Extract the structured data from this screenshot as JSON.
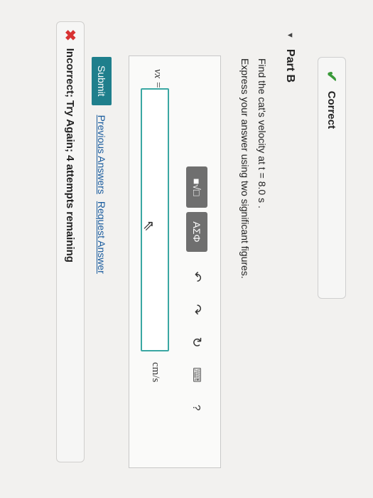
{
  "correct_panel": {
    "label": "Correct"
  },
  "part": {
    "title": "Part B"
  },
  "question": {
    "line1": "Find the cat's velocity at t = 8.0 s .",
    "line2": "Express your answer using two significant figures."
  },
  "answer": {
    "variable": "vx =",
    "units": "cm/s",
    "value": ""
  },
  "toolbar": {
    "templates_label": "■√□",
    "greek_label": "AΣΦ",
    "undo": "↶",
    "redo": "↷",
    "reset": "↻",
    "keyboard": "⌨",
    "help": "?"
  },
  "actions": {
    "submit": "Submit",
    "previous": "Previous Answers",
    "request": "Request Answer"
  },
  "feedback": {
    "text": "Incorrect; Try Again; 4 attempts remaining"
  },
  "colors": {
    "accent": "#1f7f8c",
    "input_border": "#3aa7a3",
    "correct": "#3a9a3a",
    "incorrect": "#d83232"
  }
}
